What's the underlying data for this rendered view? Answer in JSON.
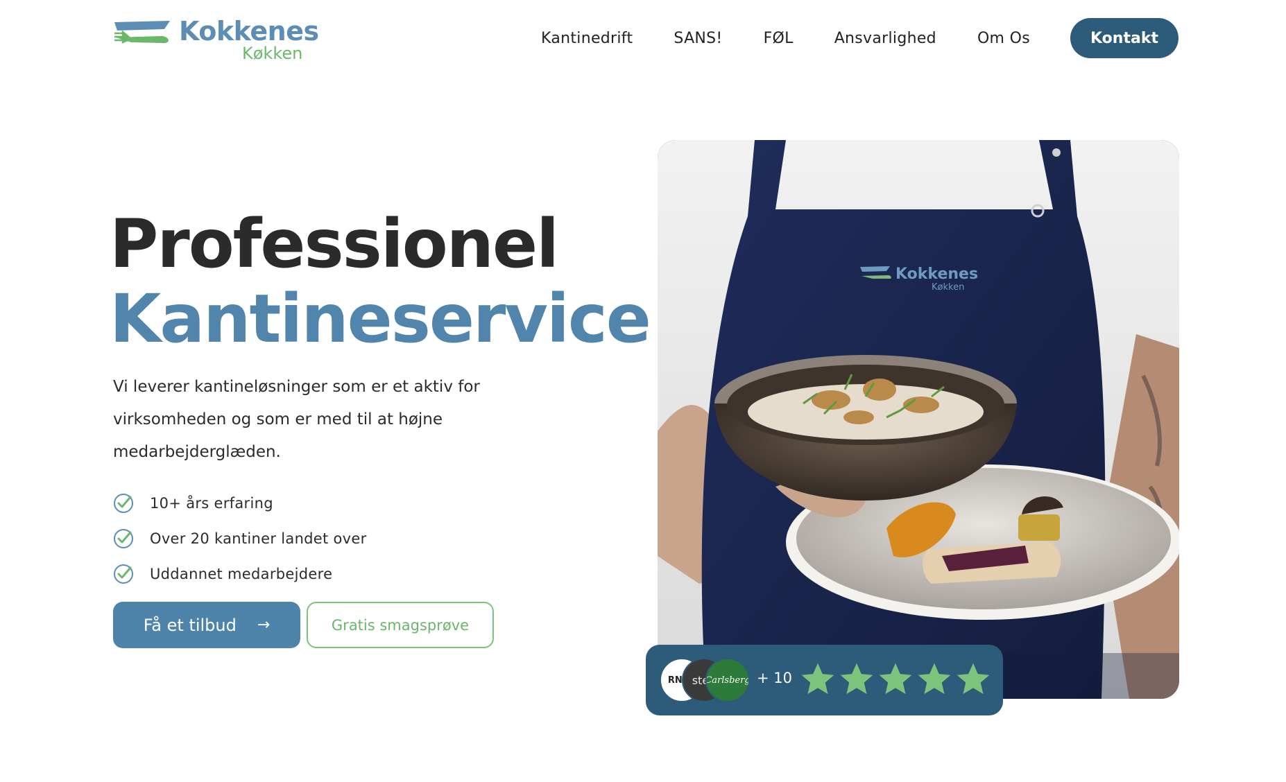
{
  "brand": {
    "name": "Kokkenes",
    "sub": "Køkken",
    "primary_color": "#5285ac",
    "secondary_color": "#6bb86a",
    "dark_color": "#2d5c7a"
  },
  "nav": {
    "items": [
      {
        "label": "Kantinedrift"
      },
      {
        "label": "SANS!"
      },
      {
        "label": "FØL"
      },
      {
        "label": "Ansvarlighed"
      },
      {
        "label": "Om Os"
      }
    ],
    "cta_label": "Kontakt"
  },
  "hero": {
    "title_line_1": "Professionel",
    "title_line_2": "Kantineservice",
    "description": "Vi leverer kantineløsninger som er et aktiv for virksomheden og som er med til at højne medarbejderglæden.",
    "features": [
      {
        "text": "10+ års erfaring",
        "icon": "check-circle-icon"
      },
      {
        "text": "Over 20 kantiner landet over",
        "icon": "check-circle-icon"
      },
      {
        "text": "Uddannet medarbejdere",
        "icon": "check-circle-icon"
      }
    ],
    "primary_button": {
      "label": "Få et tilbud",
      "icon": "arrow-right-icon",
      "arrow": "→"
    },
    "secondary_button": {
      "label": "Gratis smagsprøve"
    },
    "image_apron_text": "Kokkenes",
    "image_apron_sub": "Køkken"
  },
  "trust": {
    "clients": [
      {
        "label": "RNVA"
      },
      {
        "label": "sten"
      },
      {
        "label": "Carlsberg"
      }
    ],
    "more_count": "+ 10",
    "rating": 5,
    "star_color": "#7cc47b"
  }
}
